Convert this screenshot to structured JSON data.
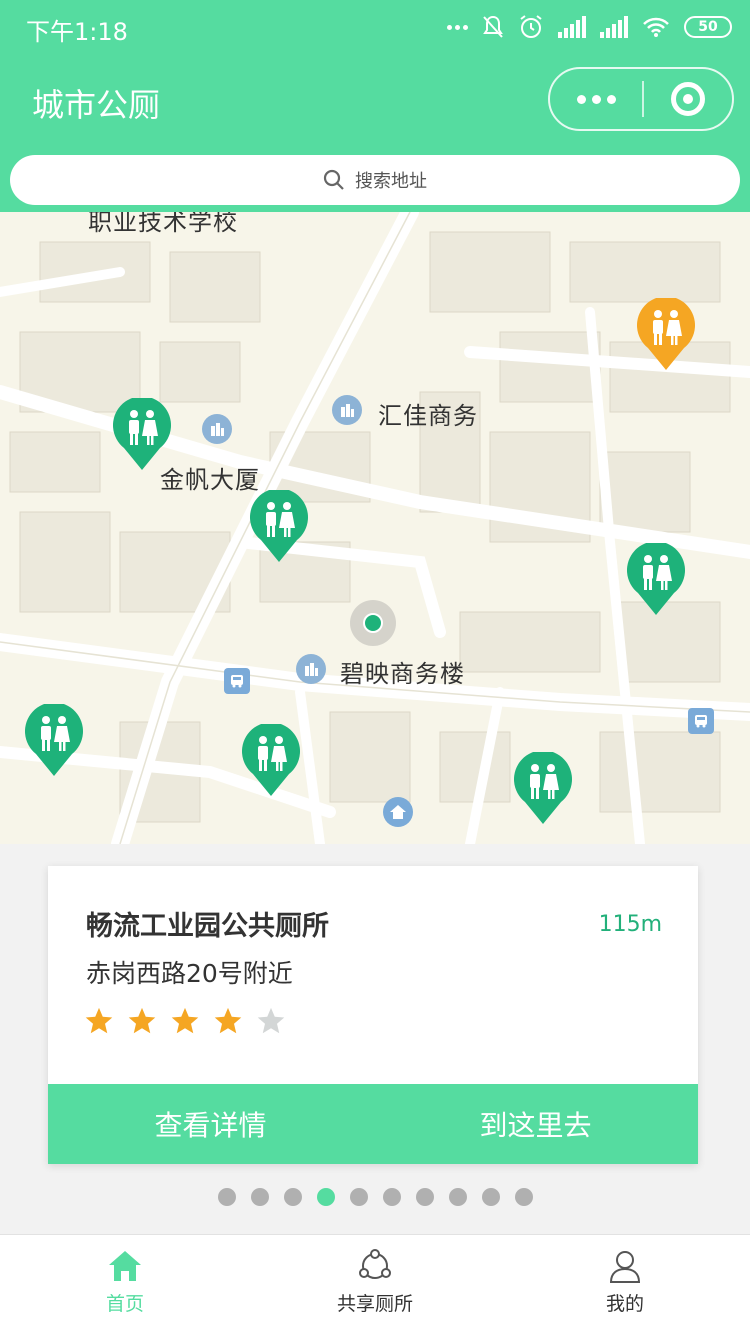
{
  "status": {
    "time": "下午1:18",
    "battery": "50"
  },
  "header": {
    "title": "城市公厕"
  },
  "search": {
    "placeholder": "搜索地址"
  },
  "map": {
    "labels": {
      "school": "职业技术学校",
      "huijia": "汇佳商务",
      "jinfan": "金帆大厦",
      "biying": "碧映商务楼"
    }
  },
  "card": {
    "name": "畅流工业园公共厕所",
    "distance": "115m",
    "address": "赤岗西路20号附近",
    "rating": 4,
    "rating_max": 5,
    "view_details": "查看详情",
    "navigate": "到这里去"
  },
  "pager": {
    "count": 10,
    "active": 3
  },
  "tabs": [
    {
      "label": "首页",
      "icon": "home-icon",
      "active": true
    },
    {
      "label": "共享厕所",
      "icon": "share-icon",
      "active": false
    },
    {
      "label": "我的",
      "icon": "user-icon",
      "active": false
    }
  ],
  "colors": {
    "accent": "#55dca0",
    "pin_green": "#1eb27a",
    "pin_orange": "#f5a623",
    "star": "#f5a623"
  }
}
